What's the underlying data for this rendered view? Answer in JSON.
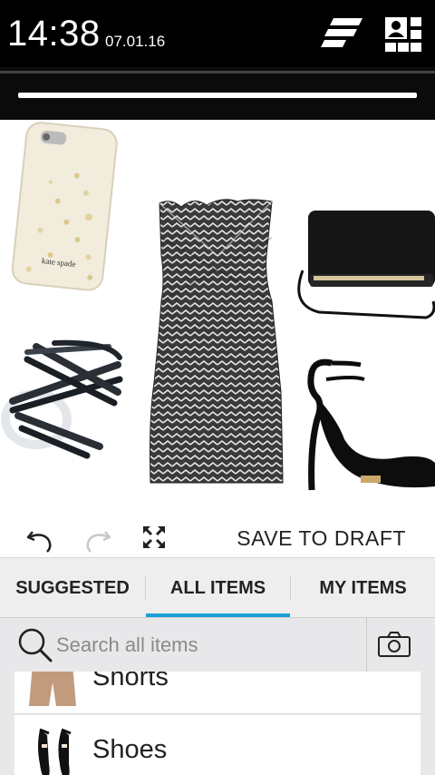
{
  "status_bar": {
    "time": "14:38",
    "date": "07.01.16"
  },
  "toolbar": {
    "save_draft_label": "SAVE TO DRAFT"
  },
  "canvas": {
    "items": [
      {
        "name": "phone-case",
        "brand_text": "kate spade"
      },
      {
        "name": "dress"
      },
      {
        "name": "handbag"
      },
      {
        "name": "ring"
      },
      {
        "name": "heels"
      }
    ]
  },
  "tabs": [
    {
      "label": "SUGGESTED"
    },
    {
      "label": "ALL ITEMS",
      "active": true
    },
    {
      "label": "MY ITEMS"
    }
  ],
  "search": {
    "placeholder": "Search all items"
  },
  "categories": [
    {
      "label": "Shorts"
    },
    {
      "label": "Shoes"
    }
  ],
  "colors": {
    "accent": "#1aa0dc",
    "status_bar": "#000000"
  }
}
